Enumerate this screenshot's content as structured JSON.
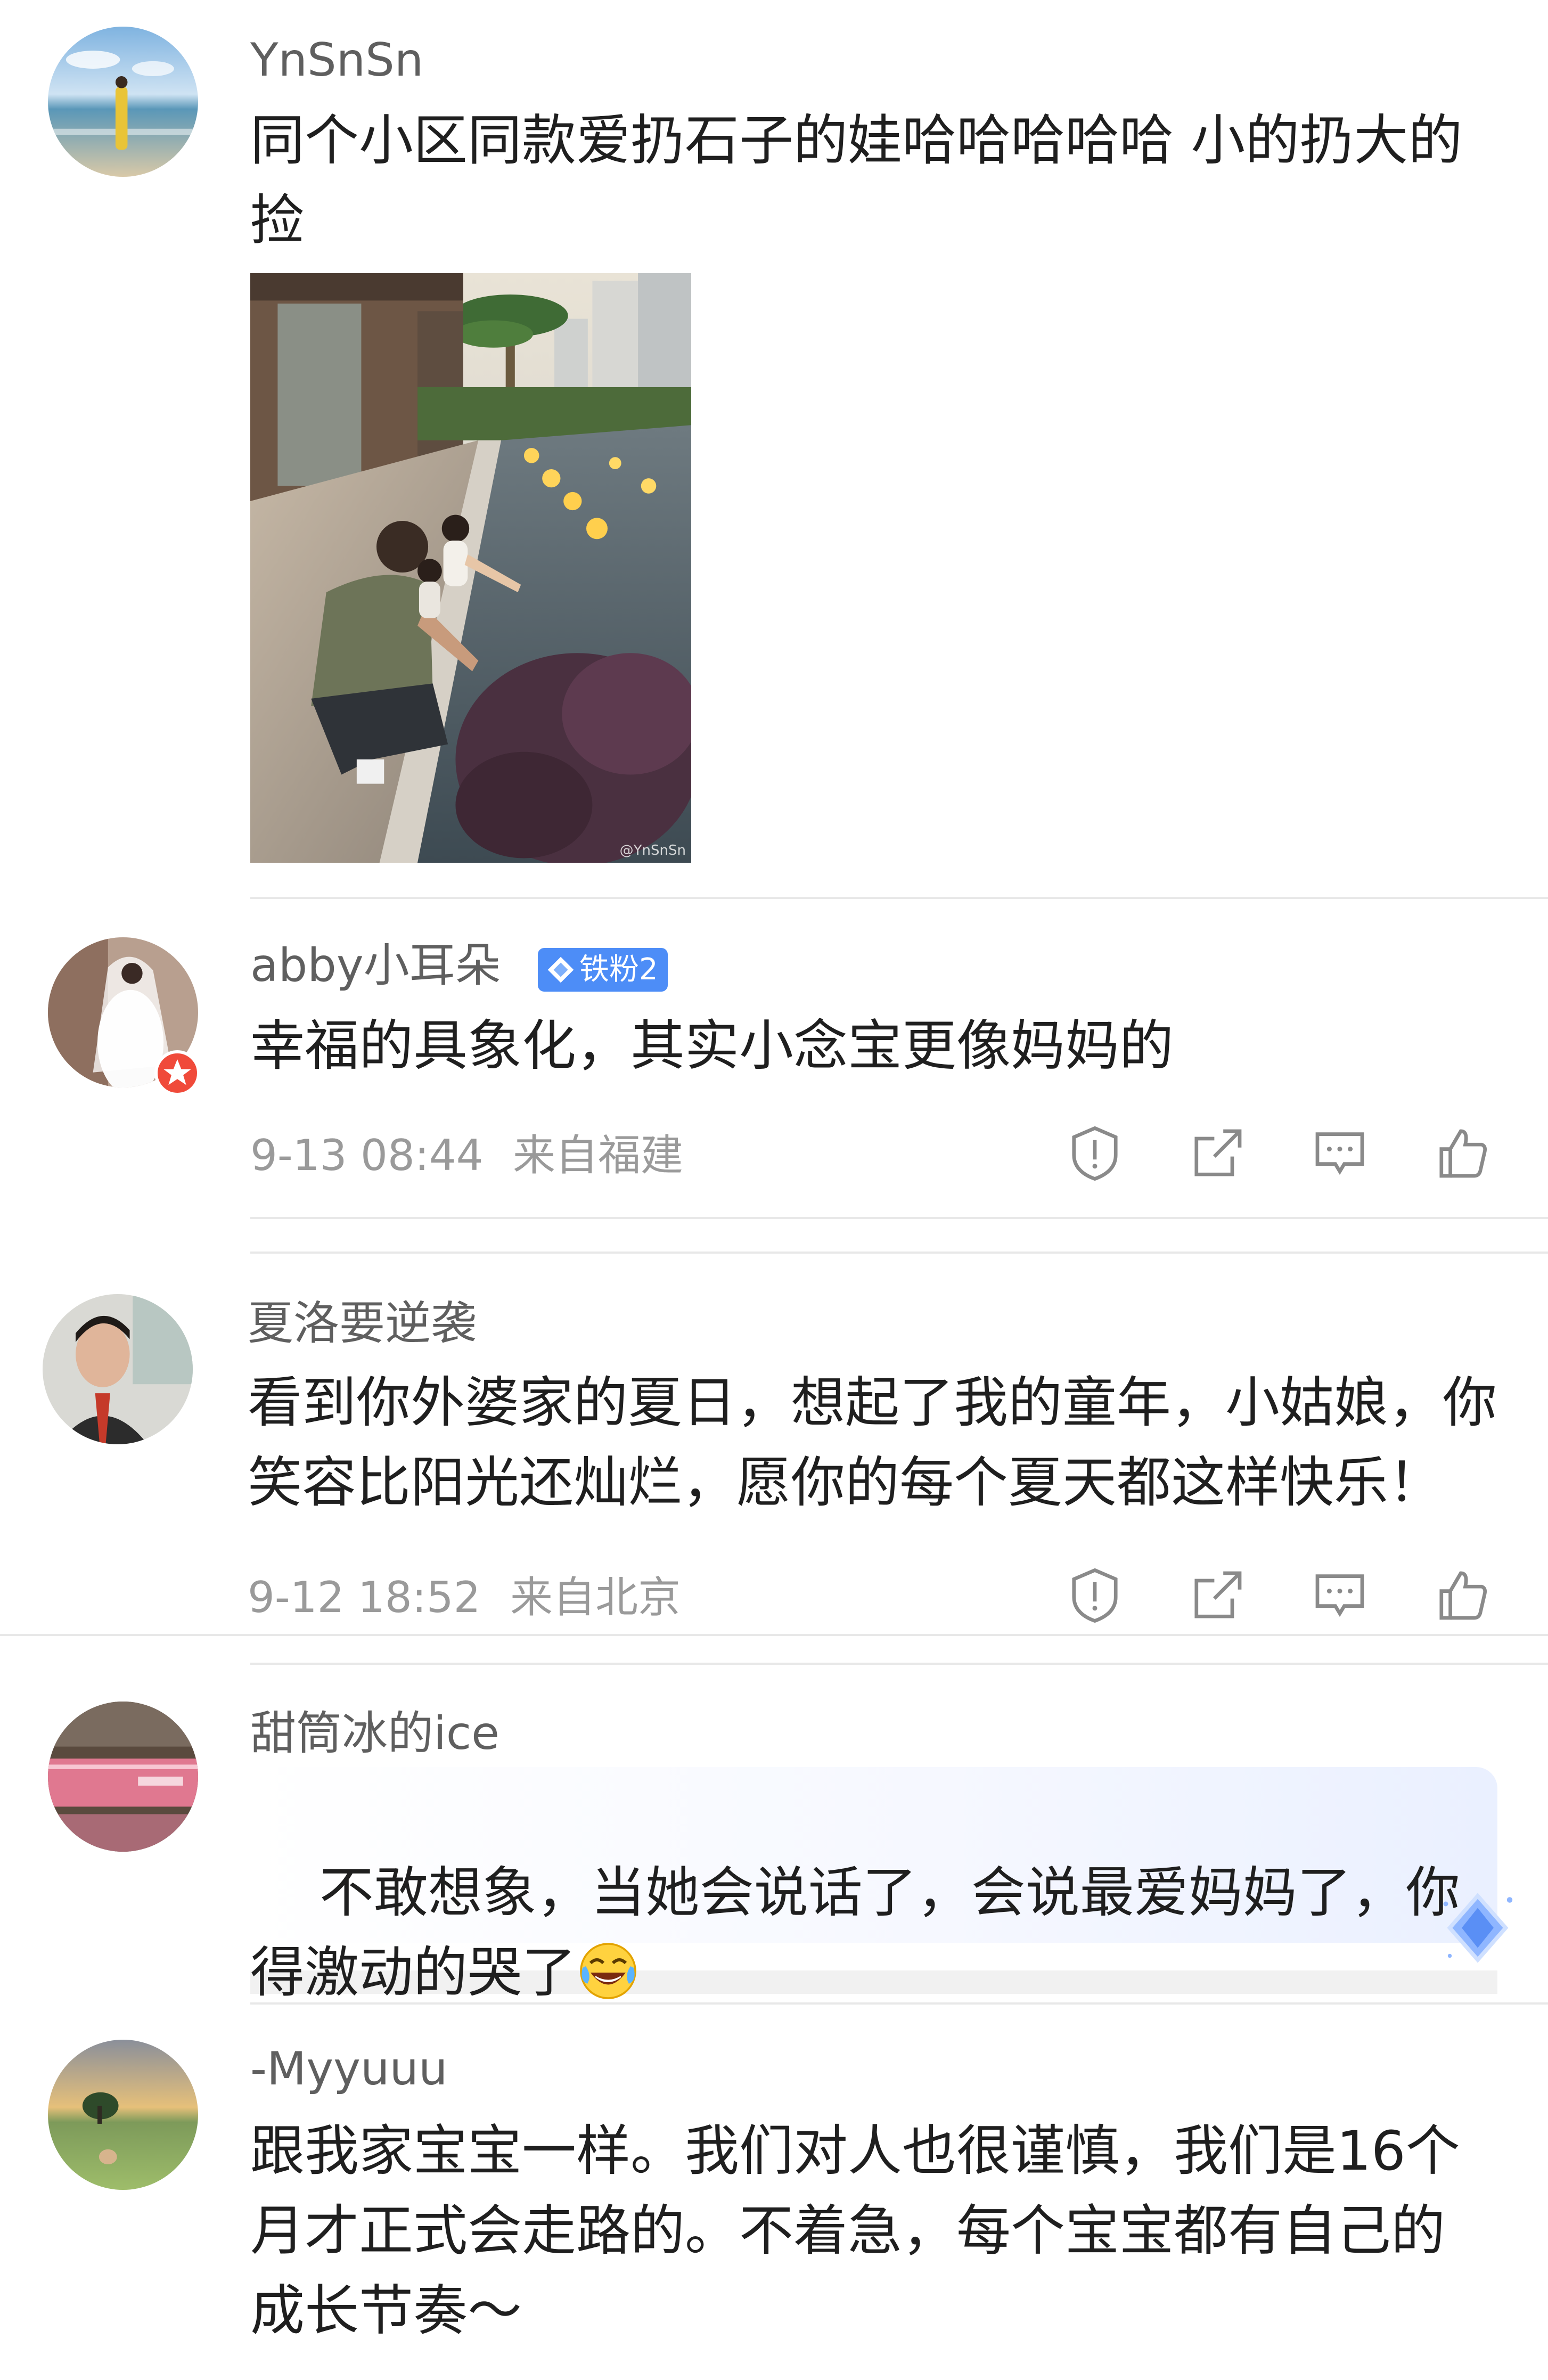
{
  "comments": [
    {
      "username": "YnSnSn",
      "text": "同个小区同款爱扔石子的娃哈哈哈哈哈 小的扔大的捡",
      "photo_credit": "@YnSnSn"
    },
    {
      "username": "abby小耳朵",
      "badge": "铁粉2",
      "text": "幸福的具象化，其实小念宝更像妈妈的",
      "date": "9-13 08:44",
      "location": "来自福建"
    },
    {
      "username": "夏洛要逆袭",
      "text": "看到你外婆家的夏日，想起了我的童年，小姑娘，你笑容比阳光还灿烂，愿你的每个夏天都这样快乐！",
      "date": "9-12 18:52",
      "location": "来自北京"
    },
    {
      "username": "甜筒冰的ice",
      "text": "不敢想象，当她会说话了，会说最爱妈妈了，你得激动的哭了",
      "emoji": "laughing-crying-emoji"
    },
    {
      "username": "-Myyuuu",
      "text": "跟我家宝宝一样。我们对人也很谨慎，我们是16个月才正式会走路的。不着急，每个宝宝都有自己的成长节奏～"
    }
  ],
  "actions": {
    "report_icon": "report-icon",
    "share_icon": "share-icon",
    "comment_icon": "comment-icon",
    "like_icon": "like-icon"
  },
  "colors": {
    "username": "#5f5f5f",
    "text": "#1f1f1f",
    "meta": "#9a9a9a",
    "badge": "#4d8df7",
    "divider": "#e8e8e8"
  }
}
